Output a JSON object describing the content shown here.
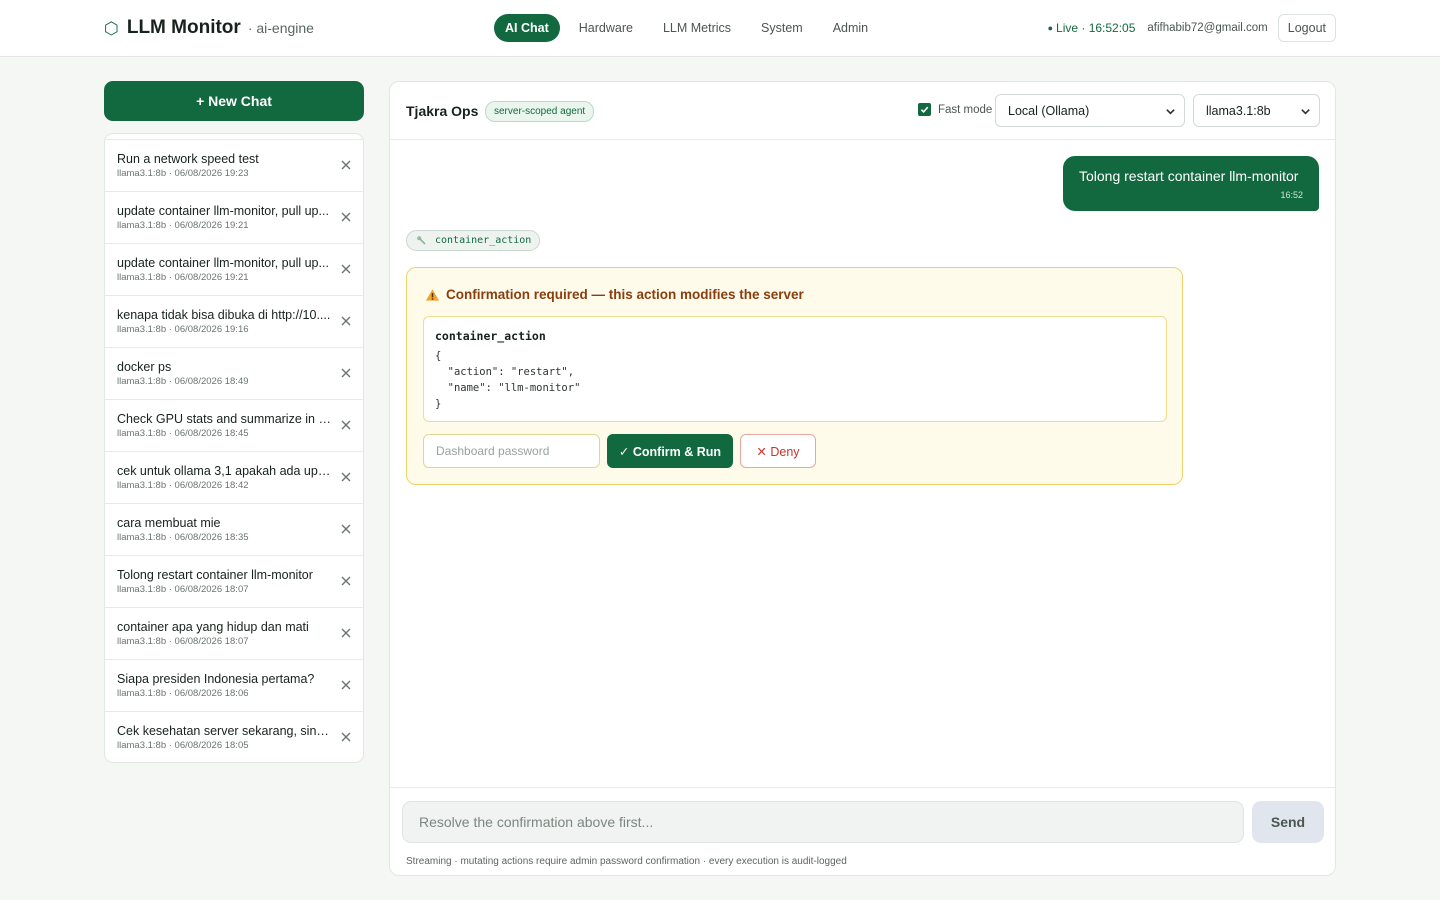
{
  "header": {
    "brand_icon": "⬡",
    "title": "LLM Monitor",
    "subtitle": "· ai-engine",
    "nav": [
      {
        "label": "AI Chat",
        "active": true
      },
      {
        "label": "Hardware",
        "active": false
      },
      {
        "label": "LLM Metrics",
        "active": false
      },
      {
        "label": "System",
        "active": false
      },
      {
        "label": "Admin",
        "active": false
      }
    ],
    "live_label": "Live · 16:52:05",
    "email": "afifhabib72@gmail.com",
    "logout_label": "Logout"
  },
  "sidebar": {
    "new_chat_label": "+ New Chat",
    "chats": [
      {
        "title": "Run a network speed test",
        "meta": "llama3.1:8b · 06/08/2026 19:23"
      },
      {
        "title": "update container llm-monitor, pull up...",
        "meta": "llama3.1:8b · 06/08/2026 19:21"
      },
      {
        "title": "update container llm-monitor, pull up...",
        "meta": "llama3.1:8b · 06/08/2026 19:21"
      },
      {
        "title": "kenapa tidak bisa dibuka di http://10....",
        "meta": "llama3.1:8b · 06/08/2026 19:16"
      },
      {
        "title": "docker ps",
        "meta": "llama3.1:8b · 06/08/2026 18:49"
      },
      {
        "title": "Check GPU stats and summarize in 2 ...",
        "meta": "llama3.1:8b · 06/08/2026 18:45"
      },
      {
        "title": "cek untuk ollama 3,1 apakah ada upd...",
        "meta": "llama3.1:8b · 06/08/2026 18:42"
      },
      {
        "title": "cara membuat mie",
        "meta": "llama3.1:8b · 06/08/2026 18:35"
      },
      {
        "title": "Tolong restart container llm-monitor",
        "meta": "llama3.1:8b · 06/08/2026 18:07"
      },
      {
        "title": "container apa yang hidup dan mati",
        "meta": "llama3.1:8b · 06/08/2026 18:07"
      },
      {
        "title": "Siapa presiden Indonesia pertama?",
        "meta": "llama3.1:8b · 06/08/2026 18:06"
      },
      {
        "title": "Cek kesehatan server sekarang, singk...",
        "meta": "llama3.1:8b · 06/08/2026 18:05"
      }
    ]
  },
  "chat": {
    "agent_name": "Tjakra Ops",
    "agent_badge": "server-scoped agent",
    "fast_mode_label": "Fast mode",
    "fast_mode_checked": true,
    "provider_value": "Local (Ollama)",
    "model_value": "llama3.1:8b",
    "user_message": {
      "text": "Tolong restart container llm-monitor",
      "time": "16:52"
    },
    "tool_chip": "container_action",
    "confirmation": {
      "title": "Confirmation required — this action modifies the server",
      "tool_name": "container_action",
      "args": "{\n  \"action\": \"restart\",\n  \"name\": \"llm-monitor\"\n}",
      "password_placeholder": "Dashboard password",
      "confirm_label": "✓ Confirm & Run",
      "deny_label": "✕ Deny"
    },
    "input_placeholder": "Resolve the confirmation above first...",
    "send_label": "Send",
    "hint": "Streaming · mutating actions require admin password confirmation · every execution is audit-logged"
  },
  "colors": {
    "accent": "#13693f",
    "warning_bg": "#fefbea",
    "warning_border": "#eed36a",
    "deny": "#c8352c"
  },
  "icons": {
    "brand": "hexagon-icon",
    "chat_delete": "close-icon",
    "select": "chevron-down-icon",
    "tool": "wrench-icon",
    "warning": "warning-icon",
    "checkbox": "check-icon"
  }
}
